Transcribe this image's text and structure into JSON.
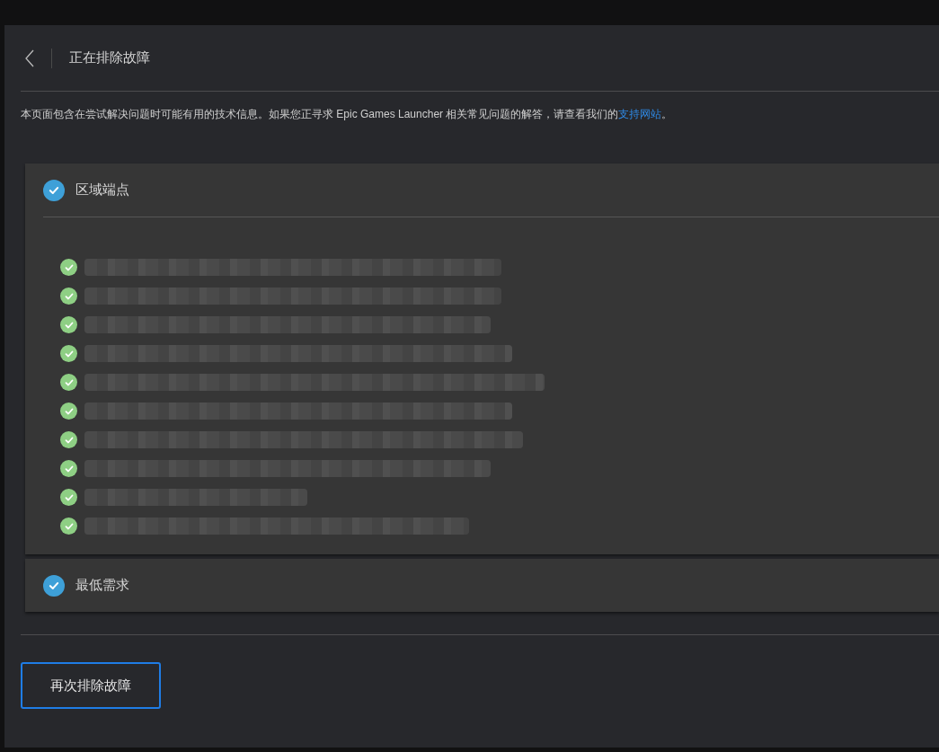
{
  "header": {
    "title": "正在排除故障"
  },
  "intro": {
    "text": "本页面包含在尝试解决问题时可能有用的技术信息。如果您正寻求 Epic Games Launcher 相关常见问题的解答，请查看我们的",
    "link": "支持网站",
    "after": "。"
  },
  "sections": [
    {
      "title": "区域端点",
      "passed": true,
      "expanded": true,
      "items": [
        {
          "passed": true
        },
        {
          "passed": true
        },
        {
          "passed": true
        },
        {
          "passed": true
        },
        {
          "passed": true
        },
        {
          "passed": true
        },
        {
          "passed": true
        },
        {
          "passed": true
        },
        {
          "passed": true
        },
        {
          "passed": true
        }
      ]
    },
    {
      "title": "最低需求",
      "passed": true,
      "expanded": false
    }
  ],
  "button": "再次排除故障"
}
